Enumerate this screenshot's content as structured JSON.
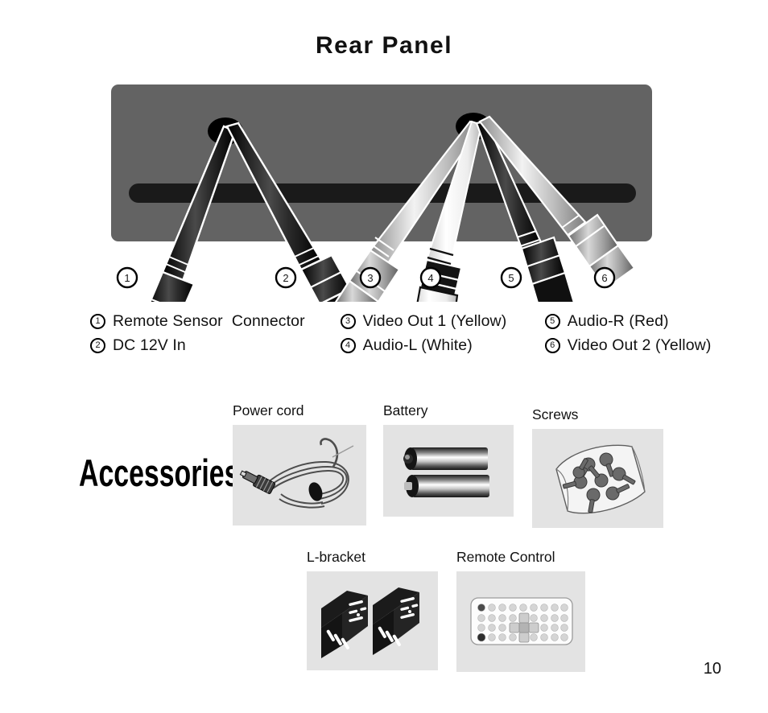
{
  "page": {
    "title": "Rear Panel",
    "page_number": "10"
  },
  "rear_panel": {
    "panel_color": "#636363",
    "slot_color": "#1a1a1a",
    "grommet_color": "#000000",
    "connectors": [
      {
        "id": "1",
        "marker": "1",
        "tone": "#111111"
      },
      {
        "id": "2",
        "marker": "2",
        "tone": "#111111"
      },
      {
        "id": "3",
        "marker": "3",
        "tone": "#b8b8b8"
      },
      {
        "id": "4",
        "marker": "4",
        "tone": "#fafafa"
      },
      {
        "id": "5",
        "marker": "5",
        "tone": "#1c1c1c"
      },
      {
        "id": "6",
        "marker": "6",
        "tone": "#c2c2c2"
      }
    ]
  },
  "legend": {
    "rows": [
      {
        "left": {
          "num": "1",
          "label": "Remote Sensor  Connector"
        },
        "middle": {
          "num": "3",
          "label": "Video Out 1 (Yellow)"
        },
        "right": {
          "num": "5",
          "label": "Audio-R (Red)"
        }
      },
      {
        "left": {
          "num": "2",
          "label": "DC 12V In"
        },
        "middle": {
          "num": "4",
          "label": "Audio-L (White)"
        },
        "right": {
          "num": "6",
          "label": "Video Out 2 (Yellow)"
        }
      }
    ]
  },
  "accessories": {
    "heading": "Accessories",
    "box_background": "#e3e3e3",
    "items": [
      {
        "name": "power-cord",
        "caption": "Power cord"
      },
      {
        "name": "battery",
        "caption": "Battery"
      },
      {
        "name": "screws",
        "caption": "Screws"
      },
      {
        "name": "l-bracket",
        "caption": "L-bracket"
      },
      {
        "name": "remote-control",
        "caption": "Remote Control"
      }
    ]
  }
}
